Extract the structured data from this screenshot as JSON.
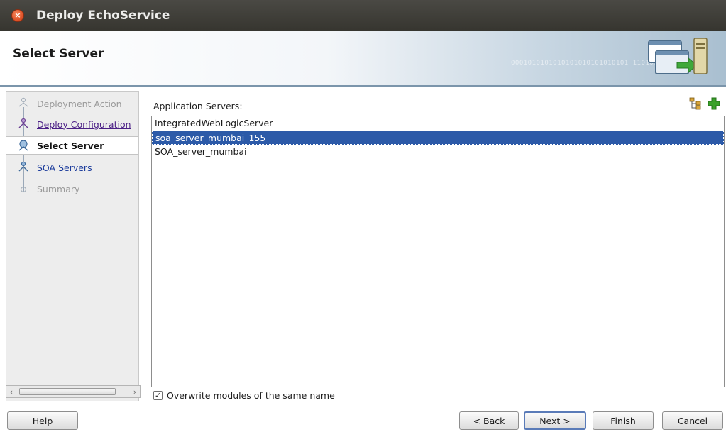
{
  "window": {
    "title": "Deploy EchoService"
  },
  "header": {
    "title": "Select Server",
    "binary_text": "0001010101010101010101010101 1101010101010"
  },
  "nav": {
    "items": [
      {
        "label": "Deployment Action",
        "state": "disabled"
      },
      {
        "label": "Deploy Configuration",
        "state": "link"
      },
      {
        "label": "Select Server",
        "state": "current"
      },
      {
        "label": "SOA Servers",
        "state": "link"
      },
      {
        "label": "Summary",
        "state": "disabled"
      }
    ]
  },
  "main": {
    "list_label": "Application Servers:",
    "servers": [
      {
        "name": "IntegratedWebLogicServer",
        "selected": false
      },
      {
        "name": "soa_server_mumbai_155",
        "selected": true
      },
      {
        "name": "SOA_server_mumbai",
        "selected": false
      }
    ],
    "overwrite": {
      "label": "Overwrite modules of the same name",
      "checked": true
    }
  },
  "buttons": {
    "help": "Help",
    "back": "< Back",
    "next": "Next >",
    "finish": "Finish",
    "cancel": "Cancel"
  },
  "icons": {
    "close": "close-icon",
    "header": "deploy-server-icon",
    "browse": "server-tree-icon",
    "add": "add-plus-icon"
  },
  "colors": {
    "titlebar": "#3f3e39",
    "selection": "#2c5aa8",
    "link_purple": "#4b1f86",
    "link_blue": "#1c3c9c",
    "add_green": "#3aa12a"
  }
}
